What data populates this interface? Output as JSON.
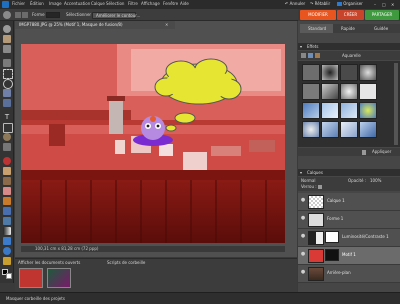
{
  "menu": {
    "items": [
      "Fichier",
      "Édition",
      "Image",
      "Accentuation",
      "Calque",
      "Sélection",
      "Filtre",
      "Affichage",
      "Fenêtre",
      "Aide"
    ],
    "annuler_label": "Annuler",
    "retablir_label": "Rétablir",
    "organiser_label": "Organiser"
  },
  "options": {
    "forme_label": "Forme",
    "selectionner_label": "Sélectionner",
    "ameliorer_label": "Améliorer le contour..."
  },
  "mode_tabs": {
    "modifier": "MODIFIER",
    "creer": "CRÉER",
    "partager": "PARTAGER"
  },
  "colors": {
    "modifier_tab": "#e8551f",
    "creer_tab": "#c8452b",
    "partager_tab": "#3f9a3f",
    "canvas_tint": "#d93a36"
  },
  "panel_tabs": {
    "standard": "Standard",
    "rapide": "Rapide",
    "guidee": "Guidée"
  },
  "document": {
    "title": "IMGP7880.JPG @ 25% (Motif 1, Masque de fusion/8)",
    "status": "100,31 cm x 81,28 cm (72 ppp)"
  },
  "effects": {
    "header": "Effets",
    "category_value": "Aquarelle",
    "appliquer_label": "Appliquer"
  },
  "layers": {
    "header": "Calques",
    "mode_value": "Normal",
    "opacity_label": "Opacité :",
    "opacity_value": "100%",
    "lock_label": "Verrou :",
    "items": [
      {
        "name": "Calque 1"
      },
      {
        "name": "Forme 1"
      },
      {
        "name": "Luminosité/Contraste 1"
      },
      {
        "name": "Motif 1"
      },
      {
        "name": "Arrière-plan"
      }
    ]
  },
  "bin": {
    "show_label": "Afficher les documents ouverts",
    "scripts_label": "Scripts de corbeille"
  },
  "footer": {
    "hide_label": "Masquer corbeille des projets"
  }
}
